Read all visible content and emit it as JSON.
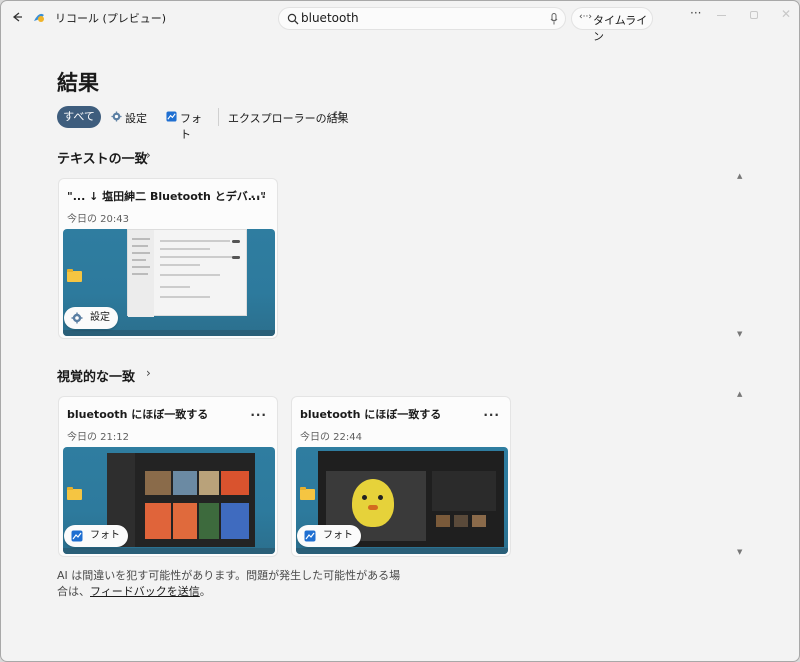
{
  "titlebar": {
    "app_title": "リコール (プレビュー)",
    "search_value": "bluetooth",
    "timeline_icon": "‹··›",
    "timeline_label": "タイムライン",
    "more": "···"
  },
  "page": {
    "title": "結果"
  },
  "filters": {
    "all": "すべて",
    "settings": "設定",
    "photos": "フォト",
    "explorer": "エクスプローラーの結果"
  },
  "text_match": {
    "section_title": "テキストの一致",
    "cards": [
      {
        "title": "\"... ↓ 塩田紳二 Bluetooth とデバ...\"",
        "time": "今日の 20:43",
        "tag": "設定"
      }
    ]
  },
  "visual_match": {
    "section_title": "視覚的な一致",
    "cards": [
      {
        "title": "bluetooth にほぼ一致する",
        "time": "今日の 21:12",
        "tag": "フォト"
      },
      {
        "title": "bluetooth にほぼ一致する",
        "time": "今日の 22:44",
        "tag": "フォト"
      }
    ]
  },
  "footer": {
    "disclaimer_prefix": "AI は間違いを犯す可能性があります。問題が発生した可能性がある場合は、",
    "feedback_link": "フィードバックを送信",
    "disclaimer_suffix": "。"
  },
  "colors": {
    "accent": "#3e5d7d",
    "window_bg": "#f3f3f3",
    "thumb_bg": "#2f7da0"
  },
  "icons": [
    "back-arrow-icon",
    "recall-app-icon",
    "search-icon",
    "microphone-icon",
    "timeline-icon",
    "settings-gear-icon",
    "photos-icon",
    "external-link-icon",
    "chevron-right-icon",
    "more-options-icon",
    "folder-icon"
  ]
}
